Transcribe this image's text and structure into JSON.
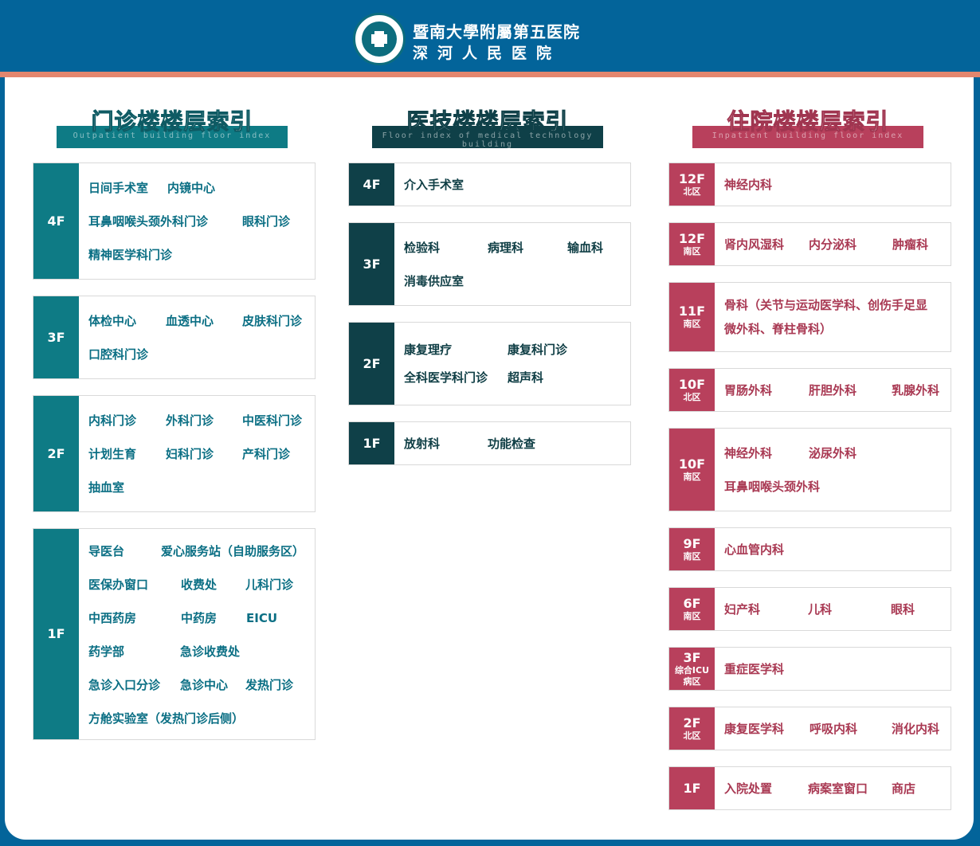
{
  "header": {
    "line1": "暨南大學附屬第五医院",
    "line2": "深河人民医院",
    "colors": {
      "background": "#03649a",
      "accent": "#e4866e"
    }
  },
  "columns": [
    {
      "title": "门诊楼楼层索引",
      "subtitle": "Outpatient building floor index",
      "color": "#0e7b85",
      "floors": [
        {
          "floor": "4F",
          "items": [
            "日间手术室",
            "内镜中心",
            "耳鼻咽喉头颈外科门诊",
            "眼科门诊",
            "精神医学科门诊"
          ]
        },
        {
          "floor": "3F",
          "items": [
            "体检中心",
            "血透中心",
            "皮肤科门诊",
            "口腔科门诊"
          ]
        },
        {
          "floor": "2F",
          "items": [
            "内科门诊",
            "外科门诊",
            "中医科门诊",
            "计划生育",
            "妇科门诊",
            "产科门诊",
            "抽血室"
          ]
        },
        {
          "floor": "1F",
          "items": [
            "导医台",
            "爱心服务站（自助服务区）",
            "医保办窗口",
            "收费处",
            "儿科门诊",
            "中西药房",
            "中药房",
            "EICU",
            "药学部",
            "急诊收费处",
            "急诊入口分诊",
            "急诊中心",
            "发热门诊",
            "方舱实验室（发热门诊后侧）"
          ]
        }
      ]
    },
    {
      "title": "医技楼楼层索引",
      "subtitle": "Floor index of medical technology building",
      "color": "#0f4048",
      "floors": [
        {
          "floor": "4F",
          "items": [
            "介入手术室"
          ]
        },
        {
          "floor": "3F",
          "items": [
            "检验科",
            "病理科",
            "输血科",
            "消毒供应室"
          ]
        },
        {
          "floor": "2F",
          "items": [
            "康复理疗",
            "康复科门诊",
            "全科医学科门诊",
            "超声科"
          ]
        },
        {
          "floor": "1F",
          "items": [
            "放射科",
            "功能检查"
          ]
        }
      ]
    },
    {
      "title": "住院楼楼层索引",
      "subtitle": "Inpatient building floor index",
      "color": "#b8405c",
      "floors": [
        {
          "floor": "12F",
          "zone": "北区",
          "items": [
            "神经内科"
          ]
        },
        {
          "floor": "12F",
          "zone": "南区",
          "items": [
            "肾内风湿科",
            "内分泌科",
            "肿瘤科"
          ]
        },
        {
          "floor": "11F",
          "zone": "南区",
          "items": [
            "骨科（关节与运动医学科、创伤手足显",
            "微外科、脊柱骨科）"
          ]
        },
        {
          "floor": "10F",
          "zone": "北区",
          "items": [
            "胃肠外科",
            "肝胆外科",
            "乳腺外科"
          ]
        },
        {
          "floor": "10F",
          "zone": "南区",
          "items": [
            "神经外科",
            "泌尿外科",
            "耳鼻咽喉头颈外科"
          ]
        },
        {
          "floor": "9F",
          "zone": "南区",
          "items": [
            "心血管内科"
          ]
        },
        {
          "floor": "6F",
          "zone": "南区",
          "items": [
            "妇产科",
            "儿科",
            "眼科"
          ]
        },
        {
          "floor": "3F",
          "zone": "综合ICU病区",
          "zone_lines": [
            "综合ICU",
            "病区"
          ],
          "items": [
            "重症医学科"
          ]
        },
        {
          "floor": "2F",
          "zone": "北区",
          "items": [
            "康复医学科",
            "呼吸内科",
            "消化内科"
          ]
        },
        {
          "floor": "1F",
          "items": [
            "入院处置",
            "病案室窗口",
            "商店"
          ]
        }
      ]
    }
  ]
}
